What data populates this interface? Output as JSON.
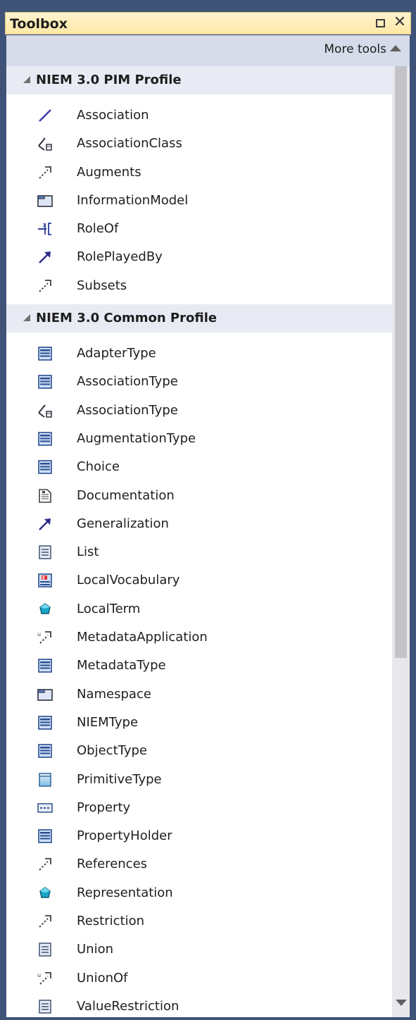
{
  "window": {
    "title": "Toolbox"
  },
  "toolbar": {
    "more_tools_label": "More tools"
  },
  "sections": [
    {
      "title": "NIEM 3.0 PIM Profile",
      "items": [
        {
          "label": "Association",
          "icon": "association-icon"
        },
        {
          "label": "AssociationClass",
          "icon": "association-class-icon"
        },
        {
          "label": "Augments",
          "icon": "dependency-icon"
        },
        {
          "label": "InformationModel",
          "icon": "package-icon"
        },
        {
          "label": "RoleOf",
          "icon": "role-of-icon"
        },
        {
          "label": "RolePlayedBy",
          "icon": "generalization-icon"
        },
        {
          "label": "Subsets",
          "icon": "dependency-icon"
        }
      ]
    },
    {
      "title": "NIEM 3.0 Common Profile",
      "items": [
        {
          "label": "AdapterType",
          "icon": "class-icon"
        },
        {
          "label": "AssociationType",
          "icon": "class-icon"
        },
        {
          "label": "AssociationType",
          "icon": "association-class-icon"
        },
        {
          "label": "AugmentationType",
          "icon": "class-icon"
        },
        {
          "label": "Choice",
          "icon": "class-icon"
        },
        {
          "label": "Documentation",
          "icon": "document-icon"
        },
        {
          "label": "Generalization",
          "icon": "generalization-icon"
        },
        {
          "label": "List",
          "icon": "list-icon"
        },
        {
          "label": "LocalVocabulary",
          "icon": "enumeration-icon"
        },
        {
          "label": "LocalTerm",
          "icon": "diamond-icon"
        },
        {
          "label": "MetadataApplication",
          "icon": "usage-icon"
        },
        {
          "label": "MetadataType",
          "icon": "class-icon"
        },
        {
          "label": "Namespace",
          "icon": "package-icon"
        },
        {
          "label": "NIEMType",
          "icon": "class-icon"
        },
        {
          "label": "ObjectType",
          "icon": "class-icon"
        },
        {
          "label": "PrimitiveType",
          "icon": "primitive-icon"
        },
        {
          "label": "Property",
          "icon": "property-icon"
        },
        {
          "label": "PropertyHolder",
          "icon": "class-icon"
        },
        {
          "label": "References",
          "icon": "dependency-icon"
        },
        {
          "label": "Representation",
          "icon": "diamond-icon"
        },
        {
          "label": "Restriction",
          "icon": "dependency-icon"
        },
        {
          "label": "Union",
          "icon": "list-icon"
        },
        {
          "label": "UnionOf",
          "icon": "usage-icon"
        },
        {
          "label": "ValueRestriction",
          "icon": "list-icon"
        }
      ]
    }
  ]
}
